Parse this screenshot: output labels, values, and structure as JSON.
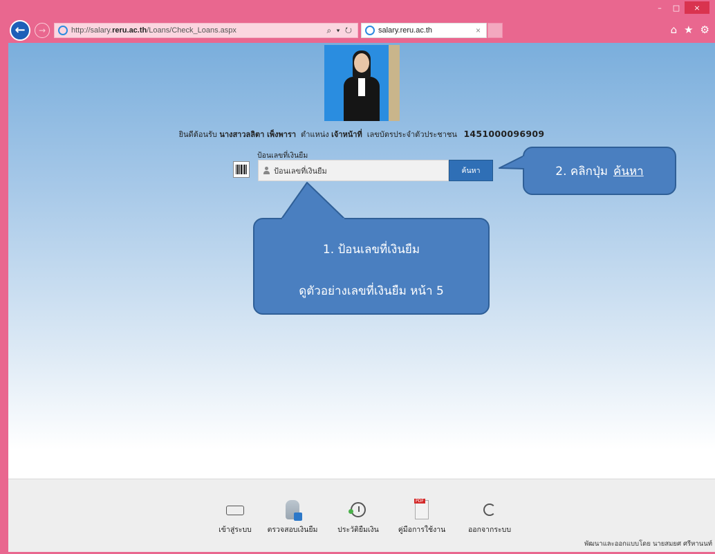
{
  "browser": {
    "url_prefix": "http://salary.",
    "url_domain": "reru.ac.th",
    "url_path": "/Loans/Check_Loans.aspx",
    "address_tools": "⌕ ▾ ↻",
    "tab_title": "salary.reru.ac.th",
    "tab_close": "×",
    "win_minimize": "–",
    "win_maximize": "□",
    "win_close": "×",
    "home_icon": "⌂",
    "star_icon": "★",
    "settings_icon": "⚙",
    "back_arrow": "←",
    "forward_arrow": "→"
  },
  "welcome": {
    "prefix": "ยินดีต้อนรับ",
    "name": "นางสาวลลิตา เพ็งพารา",
    "position_label": "ตำแหน่ง",
    "position": "เจ้าหน้าที่",
    "id_label": "เลขบัตรประจำตัวประชาชน",
    "id_number": "1451000096909"
  },
  "search": {
    "label": "ป้อนเลขที่เงินยืม",
    "placeholder": "ป้อนเลขที่เงินยืม",
    "button": "ค้นหา"
  },
  "callouts": {
    "step2_text": "2. คลิกปุ่ม",
    "step2_link": "ค้นหา",
    "step1_line1": "1. ป้อนเลขที่เงินยืม",
    "step1_line2": "ดูตัวอย่างเลขที่เงินยืม หน้า 5"
  },
  "footer": {
    "menu": [
      {
        "label": "เข้าสู่ระบบ",
        "icon": "login-icon"
      },
      {
        "label": "ตรวจสอบเงินยืม",
        "icon": "database-search-icon"
      },
      {
        "label": "ประวัติยืมเงิน",
        "icon": "history-clock-icon"
      },
      {
        "label": "คู่มือการใช้งาน",
        "icon": "pdf-manual-icon"
      },
      {
        "label": "ออกจากระบบ",
        "icon": "logout-icon"
      }
    ],
    "credit": "พัฒนาและออกแบบโดย นายสมยศ ศรีหานนท์"
  },
  "colors": {
    "browser_frame": "#e9678f",
    "callout_fill": "#4a7fc0",
    "button_blue": "#2f6fb6"
  }
}
